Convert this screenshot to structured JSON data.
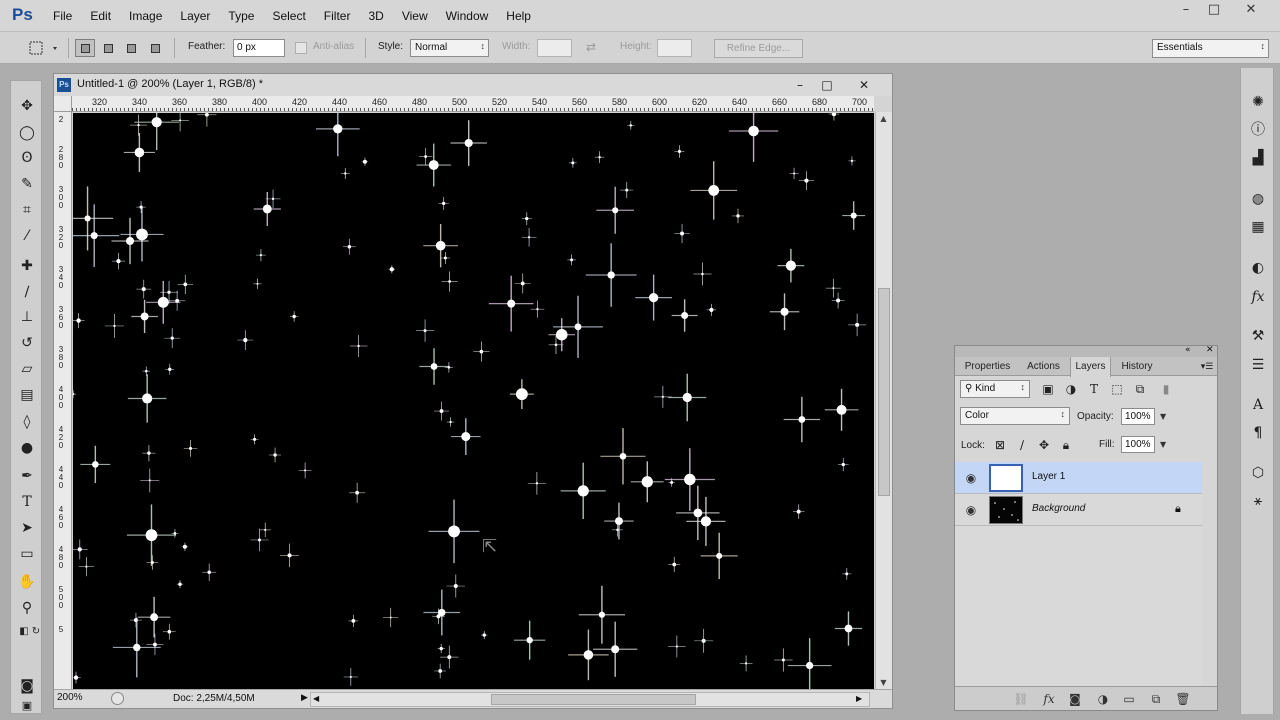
{
  "app": {
    "logo": "Ps",
    "menu": [
      "File",
      "Edit",
      "Image",
      "Layer",
      "Type",
      "Select",
      "Filter",
      "3D",
      "View",
      "Window",
      "Help"
    ],
    "window_controls": {
      "minimize": "–",
      "restore": "□",
      "close": "✕"
    }
  },
  "options": {
    "feather_label": "Feather:",
    "feather_value": "0 px",
    "antialias_label": "Anti-alias",
    "style_label": "Style:",
    "style_value": "Normal",
    "width_label": "Width:",
    "width_value": "",
    "height_label": "Height:",
    "height_value": "",
    "refine_edge": "Refine Edge...",
    "workspace": "Essentials"
  },
  "document": {
    "title": "Untitled-1 @ 200% (Layer 1, RGB/8) *",
    "icon_label": "Ps",
    "zoom": "200%",
    "info": "Doc: 2,25M/4,50M",
    "ruler_h": [
      "320",
      "340",
      "360",
      "380",
      "400",
      "420",
      "440",
      "460",
      "480",
      "500",
      "520",
      "540",
      "560",
      "580",
      "600",
      "620",
      "640",
      "660",
      "680",
      "700"
    ],
    "ruler_v": [
      "2",
      "2 8 0",
      "3 0 0",
      "3 2 0",
      "3 4 0",
      "3 6 0",
      "3 8 0",
      "4 0 0",
      "4 2 0",
      "4 4 0",
      "4 6 0",
      "4 8 0",
      "5 0 0",
      "5"
    ]
  },
  "panel": {
    "tabs": [
      "Properties",
      "Actions",
      "Layers",
      "History"
    ],
    "active_tab": "Layers",
    "filter_kind": "Kind",
    "blend_mode": "Color",
    "opacity_label": "Opacity:",
    "opacity_value": "100%",
    "lock_label": "Lock:",
    "fill_label": "Fill:",
    "fill_value": "100%",
    "layers": [
      {
        "name": "Layer 1",
        "selected": true,
        "locked": false
      },
      {
        "name": "Background",
        "selected": false,
        "locked": true
      }
    ]
  },
  "colors": {
    "foreground": "#000000",
    "background": "#ffffff",
    "selection": "#c4d6f5",
    "ps_blue": "#1b4e94"
  }
}
